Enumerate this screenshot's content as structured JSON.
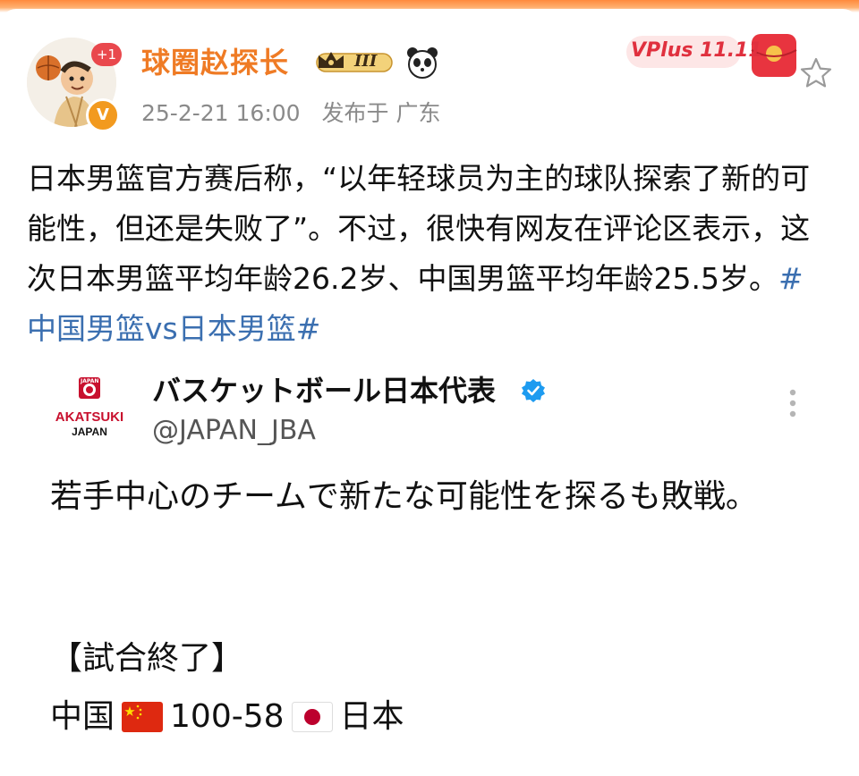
{
  "post": {
    "username": "球圈赵探长",
    "level_badge": "III",
    "avatar_plus": "+1",
    "avatar_verified": "V",
    "timestamp": "25-2-21 16:00",
    "source": "发布于 广东",
    "vplus_label": "VPlus 11.11",
    "text": "日本男篮官方赛后称，“以年轻球员为主的球队探索了新的可能性，但还是失败了”。不过，很快有网友在评论区表示，这次日本男篮平均年龄26.2岁、中国男篮平均年龄25.5岁。",
    "hashtag": "#中国男篮vs日本男篮#"
  },
  "tweet": {
    "logo_top": "JAPAN",
    "logo_main": "AKATSUKI",
    "logo_sub": "JAPAN",
    "name": "バスケットボール日本代表",
    "handle": "@JAPAN_JBA",
    "body": "若手中心のチームで新たな可能性を探るも敗戦。",
    "result_title": "【試合終了】",
    "team_home": "中国",
    "score": "100-58",
    "team_away": "日本"
  },
  "icons": {
    "verify": "verified-check-icon",
    "more": "more-vertical-icon",
    "star": "star-outline-icon",
    "panda": "panda-icon",
    "crown": "crown-icon"
  },
  "colors": {
    "username": "#ef7b25",
    "hashtag": "#3b6fb0",
    "verify": "#1d9bf0",
    "vplus": "#e0303e"
  }
}
